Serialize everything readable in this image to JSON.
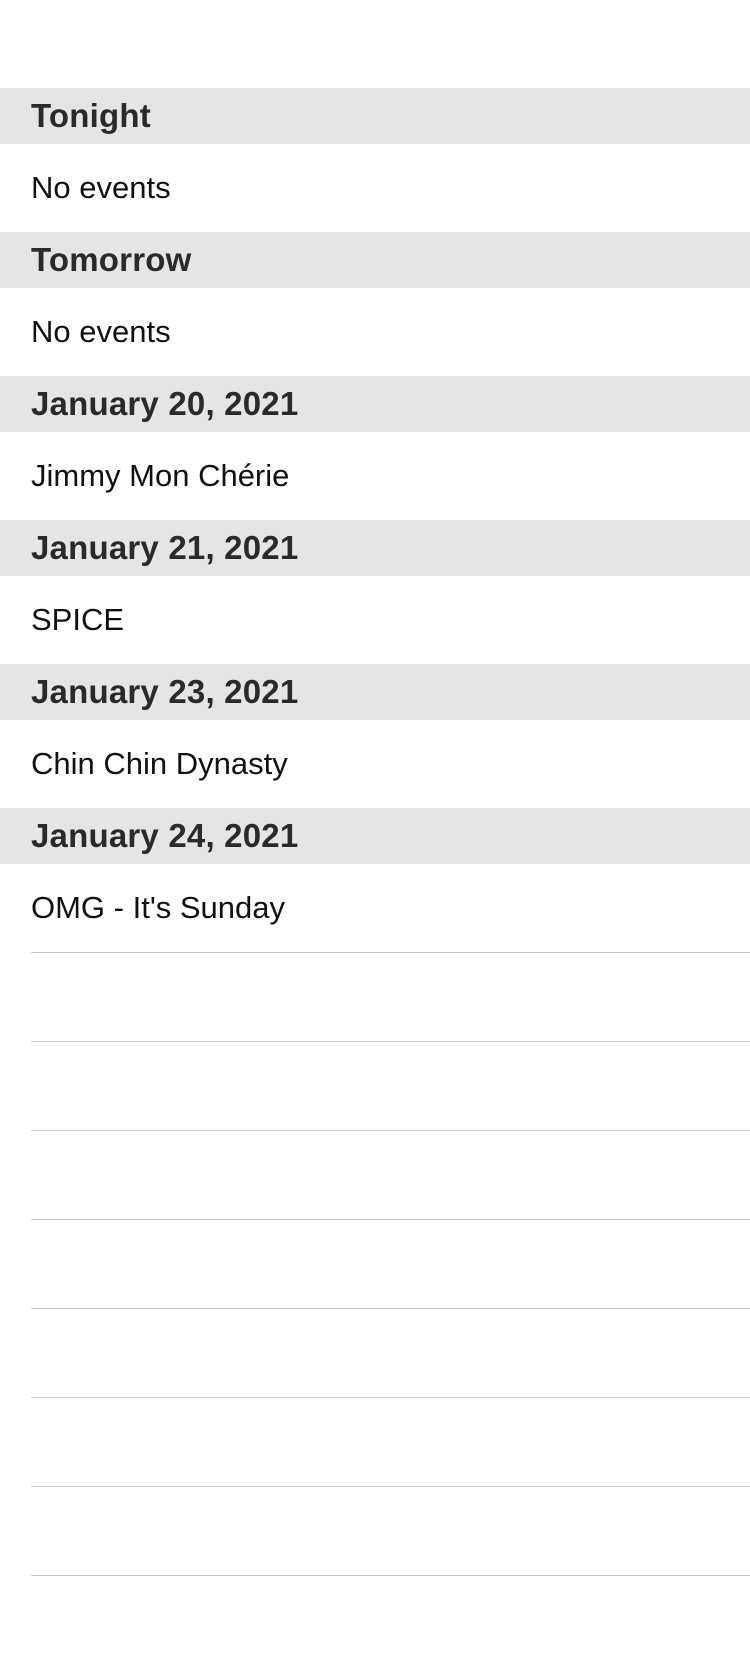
{
  "sections": [
    {
      "header": "Tonight",
      "item": "No events"
    },
    {
      "header": "Tomorrow",
      "item": "No events"
    },
    {
      "header": "January 20, 2021",
      "item": "Jimmy Mon Chérie"
    },
    {
      "header": "January 21, 2021",
      "item": "SPICE"
    },
    {
      "header": "January 23, 2021",
      "item": "Chin Chin Dynasty"
    },
    {
      "header": "January 24, 2021",
      "item": "OMG - It's Sunday"
    }
  ]
}
